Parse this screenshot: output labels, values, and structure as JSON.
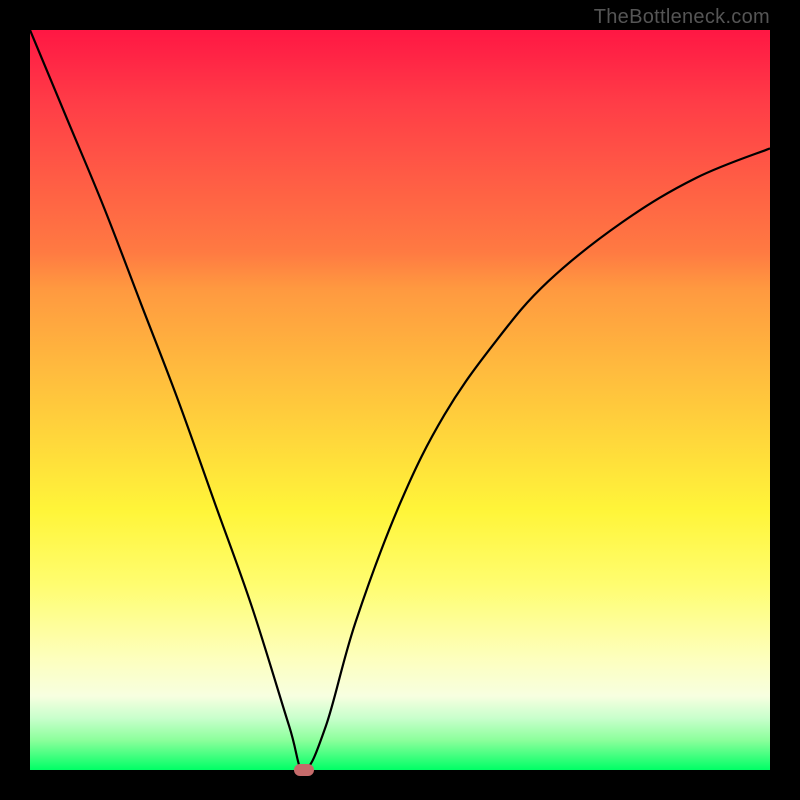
{
  "watermark": "TheBottleneck.com",
  "chart_data": {
    "type": "line",
    "title": "",
    "xlabel": "",
    "ylabel": "",
    "xlim": [
      0,
      100
    ],
    "ylim": [
      0,
      100
    ],
    "background_gradient": {
      "top": "#ff1744",
      "mid": "#fff539",
      "bottom": "#00ff66"
    },
    "series": [
      {
        "name": "bottleneck-curve",
        "x": [
          0,
          5,
          10,
          15,
          20,
          25,
          30,
          35,
          37,
          40,
          44,
          50,
          56,
          63,
          70,
          80,
          90,
          100
        ],
        "values": [
          100,
          88,
          76,
          63,
          50,
          36,
          22,
          6,
          0,
          6,
          20,
          36,
          48,
          58,
          66,
          74,
          80,
          84
        ]
      }
    ],
    "marker": {
      "x": 37,
      "y": 0,
      "color": "#c56a6a"
    }
  }
}
